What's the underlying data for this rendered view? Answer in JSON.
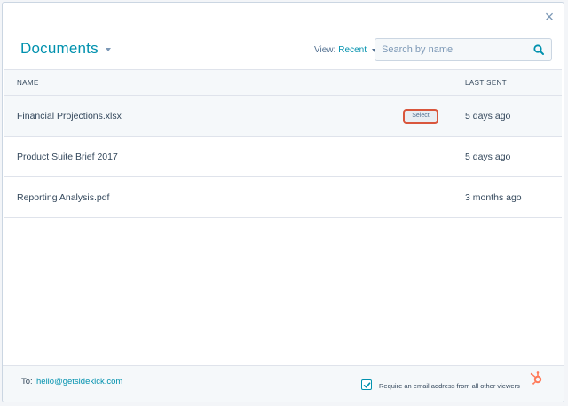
{
  "modal": {
    "title": "Documents",
    "close_glyph": "×"
  },
  "view": {
    "label": "View:",
    "value": "Recent"
  },
  "search": {
    "placeholder": "Search by name"
  },
  "table": {
    "columns": [
      "NAME",
      "LAST SENT"
    ],
    "rows": [
      {
        "name": "Financial Projections.xlsx",
        "last_sent": "5 days ago",
        "action": "Select"
      },
      {
        "name": "Product Suite Brief 2017",
        "last_sent": "5 days ago"
      },
      {
        "name": "Reporting Analysis.pdf",
        "last_sent": "3 months ago"
      }
    ]
  },
  "footer": {
    "to_label": "To:",
    "to_email": "hello@getsidekick.com",
    "require_email_checked": true,
    "require_email_label": "Require an email address from all other viewers"
  },
  "icons": {
    "close": "close-icon",
    "dropdown": "chevron-down-icon",
    "search": "search-icon",
    "check": "checkmark-icon",
    "brand": "hubspot-sprocket-icon"
  },
  "colors": {
    "accent": "#0091ae",
    "text": "#33475b",
    "highlight_border": "#d9563c",
    "brand_orange": "#ff7a59"
  }
}
